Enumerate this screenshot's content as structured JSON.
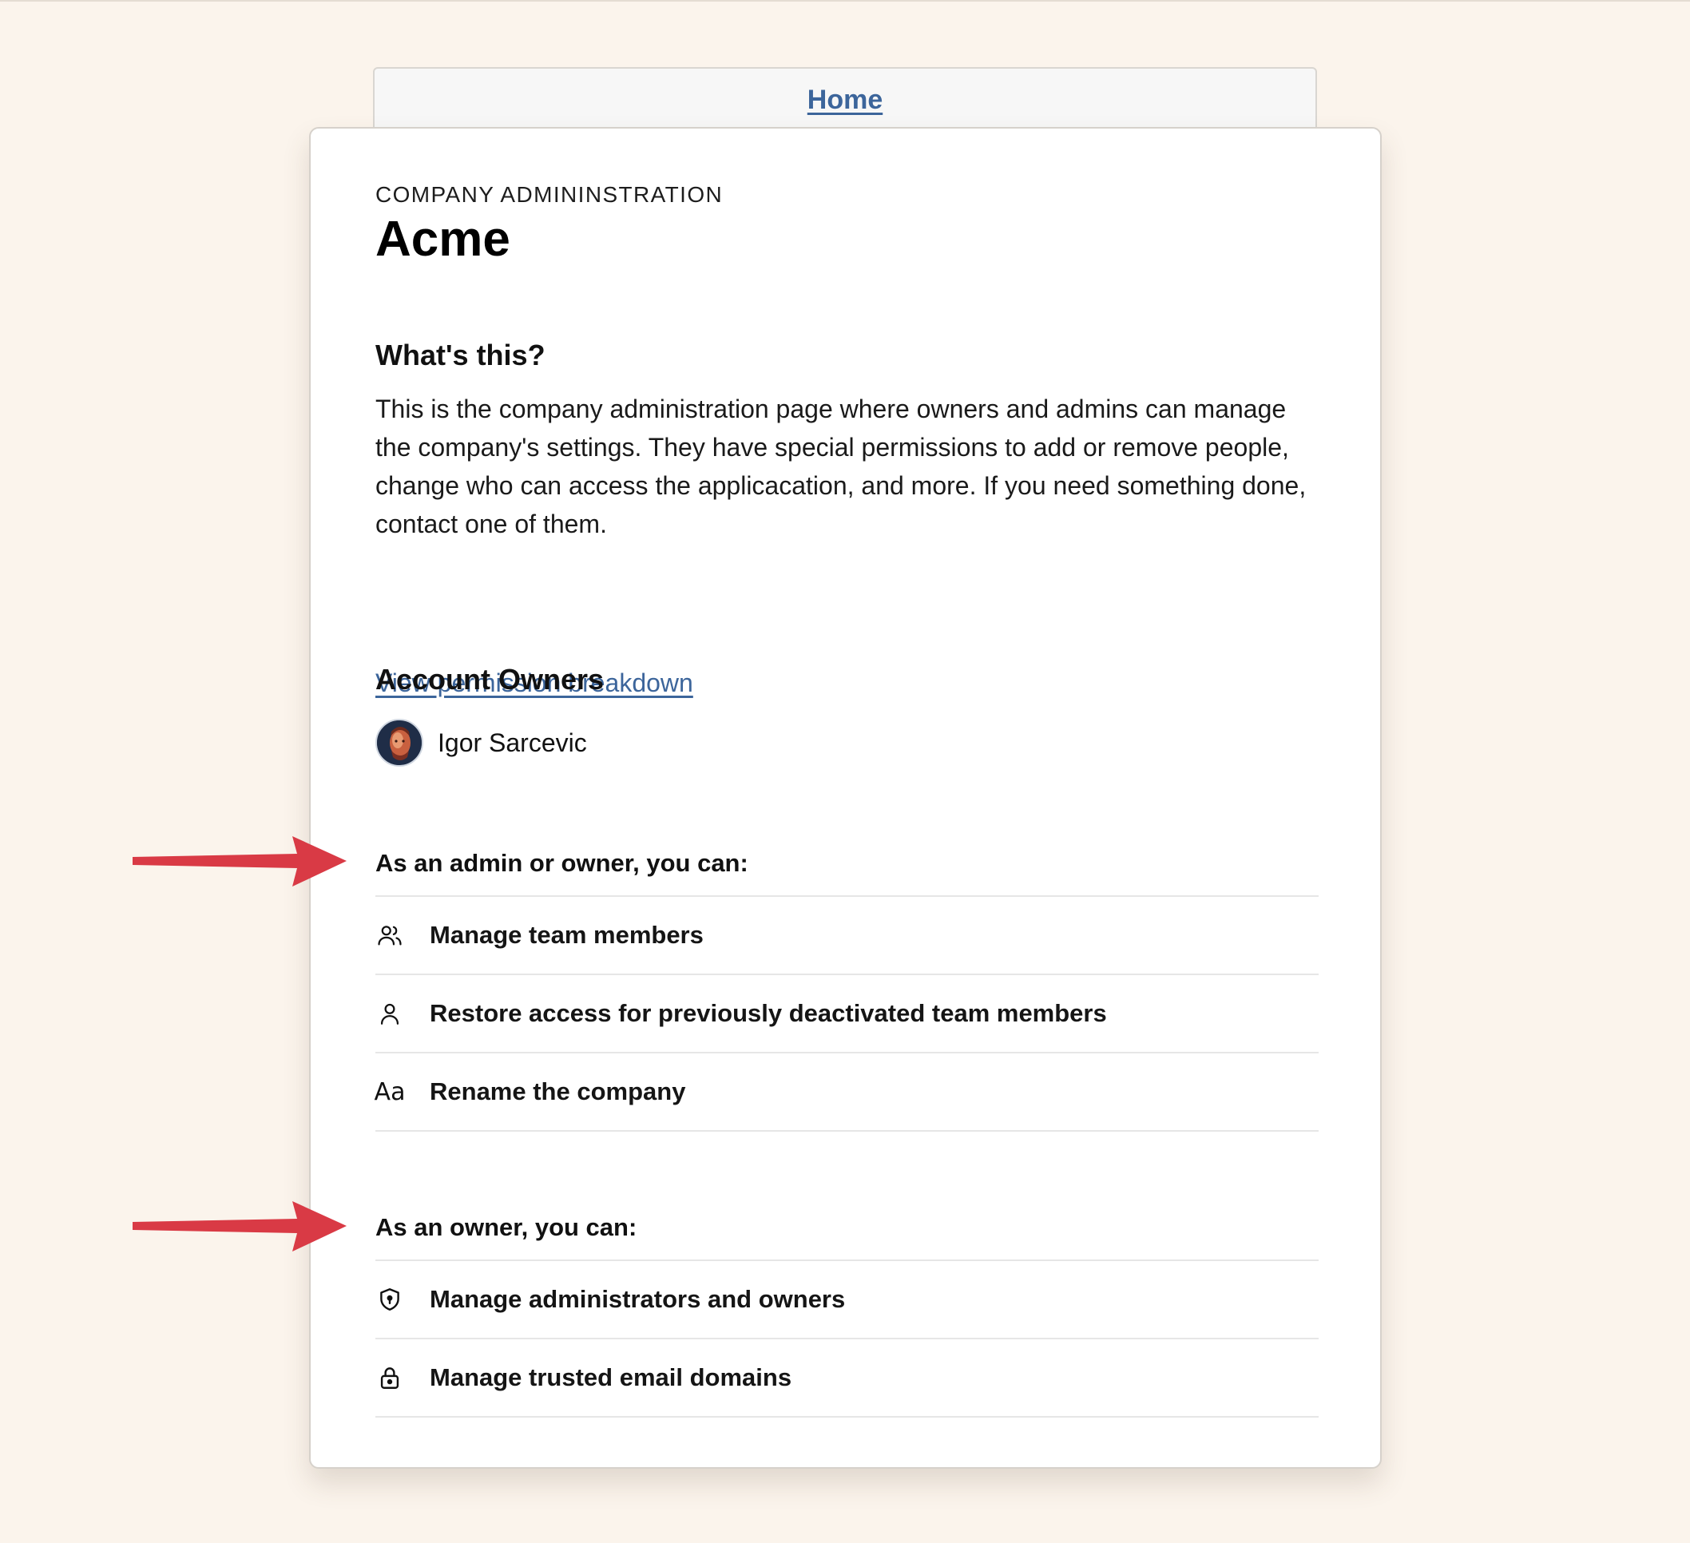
{
  "nav": {
    "home_label": "Home"
  },
  "header": {
    "eyebrow": "COMPANY ADMININSTRATION",
    "company_name": "Acme"
  },
  "about": {
    "heading": "What's this?",
    "description": "This is the company administration page where owners and admins can manage the company's settings. They have special permissions to add or remove people, change who can access the applicacation, and more. If you need something done, contact one of them.",
    "link_label": "View permission breakdown"
  },
  "owners": {
    "heading": "Account Owners",
    "people": [
      {
        "name": "Igor Sarcevic",
        "avatar_icon": "avatar-photo"
      }
    ]
  },
  "admin_permissions": {
    "heading": "As an admin or owner, you can:",
    "items": [
      {
        "label": "Manage team members",
        "icon": "users-icon"
      },
      {
        "label": "Restore access for previously deactivated team members",
        "icon": "user-icon"
      },
      {
        "label": "Rename the company",
        "icon": "text-aa-icon",
        "glyph": "Aa"
      }
    ]
  },
  "owner_permissions": {
    "heading": "As an owner, you can:",
    "items": [
      {
        "label": "Manage administrators and owners",
        "icon": "shield-icon"
      },
      {
        "label": "Manage trusted email domains",
        "icon": "lock-icon"
      }
    ]
  },
  "annotations": {
    "arrow_color": "#d93a45"
  },
  "colors": {
    "background": "#fbf4ec",
    "link": "#3c659b",
    "card": "#ffffff"
  }
}
